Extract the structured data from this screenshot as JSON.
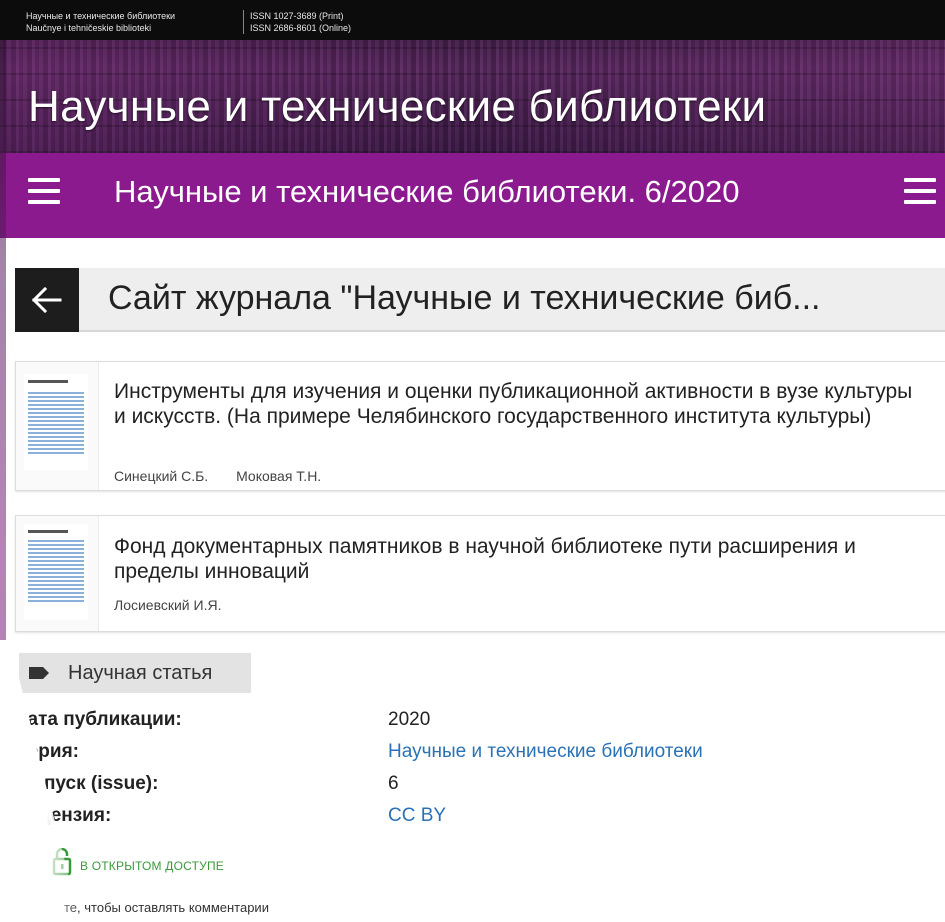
{
  "top_strip": {
    "site_name_ru": "Научные и технические библиотеки",
    "site_name_translit": "Naučnye i tehničeskie biblioteki",
    "issn_print": "ISSN 1027-3689 (Print)",
    "issn_online": "ISSN 2686-8601 (Online)"
  },
  "banner": {
    "journal_title": "Научные и технические библиотеки"
  },
  "issue_bar": {
    "title": "Научные и технические библиотеки. 6/2020",
    "menu_left_icon": "hamburger-menu-icon",
    "menu_right_icon": "hamburger-menu-icon",
    "bar_color": "#8b1a8e"
  },
  "back_header": {
    "title": "Сайт журнала \"Научные и технические биб...",
    "back_icon": "arrow-left-icon"
  },
  "articles": [
    {
      "title": "Инструменты для изучения и оценки публикационной активности в вузе культуры и искусств. (На примере Челябинского государственного института культуры)",
      "authors": [
        "Синецкий С.Б.",
        "Моковая Т.Н."
      ]
    },
    {
      "title": "Фонд документарных памятников в научной библиотеке пути расширения и пределы инноваций",
      "authors": [
        "Лосиевский И.Я."
      ]
    }
  ],
  "tag": {
    "label": "Научная статья",
    "icon": "tag-icon"
  },
  "meta": {
    "publication_date": {
      "label": "Дата публикации:",
      "value": "2020"
    },
    "series": {
      "label": "Серия:",
      "value": "Научные и технические библиотеки"
    },
    "issue": {
      "label": "Выпуск (issue):",
      "value": "6"
    },
    "license": {
      "label": "Лицензия:",
      "value": "CC BY"
    }
  },
  "open_access": {
    "label": "В ОТКРЫТОМ ДОСТУПЕ",
    "icon": "unlock-icon",
    "color": "#3a9a3a"
  },
  "comment_hint": "те, чтобы оставлять комментарии",
  "colors": {
    "accent_purple": "#8b1a8e",
    "link_blue": "#2a72b5"
  }
}
